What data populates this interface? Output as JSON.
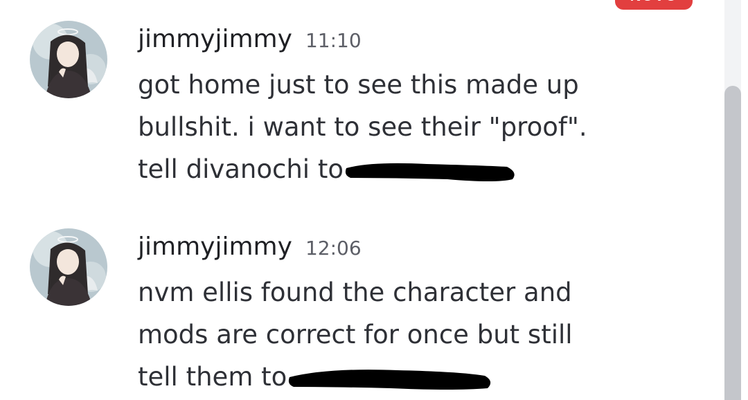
{
  "badge": {
    "label": "NOVO"
  },
  "messages": [
    {
      "username": "jimmyjimmy",
      "timestamp": "11:10",
      "lines": [
        "got home just to see this made up",
        "bullshit. i want to see their \"proof\".",
        "tell divanochi to"
      ],
      "avatar_icon": "anime-girl-angel-halo-avatar"
    },
    {
      "username": "jimmyjimmy",
      "timestamp": "12:06",
      "lines": [
        "nvm ellis found the character and",
        "mods are correct for once but still",
        "tell them to"
      ],
      "avatar_icon": "anime-girl-angel-halo-avatar"
    }
  ],
  "colors": {
    "badge": "#e23f3f",
    "text": "#2e3036",
    "timestamp": "#5c5e66",
    "redaction": "#000000",
    "scrollbar_thumb": "#c4c6cb"
  }
}
